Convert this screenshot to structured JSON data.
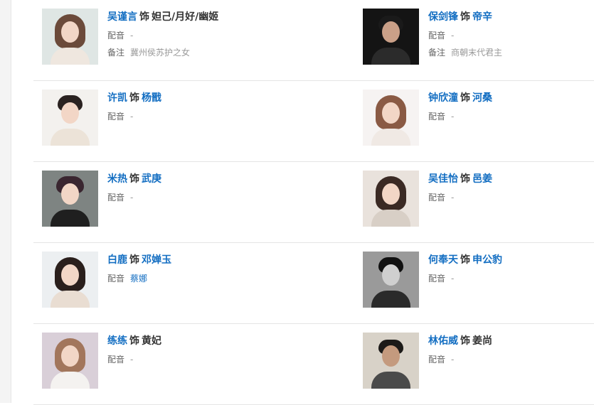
{
  "separator": "饰",
  "label_voice": "配音",
  "label_note": "备注",
  "rows": [
    {
      "left": {
        "actor": "吴谨言",
        "role": "妲己/月好/幽姬",
        "voice": "-",
        "note": "冀州侯苏护之女"
      },
      "right": {
        "actor": "保剑锋",
        "role": "帝辛",
        "voice": "-",
        "note": "商朝末代君主"
      }
    },
    {
      "left": {
        "actor": "许凯",
        "role": "杨戬",
        "voice": "-"
      },
      "right": {
        "actor": "钟欣潼",
        "role": "河桑",
        "voice": "-"
      }
    },
    {
      "left": {
        "actor": "米热",
        "role": "武庚",
        "voice": "-"
      },
      "right": {
        "actor": "吴佳怡",
        "role": "邑姜",
        "voice": "-"
      }
    },
    {
      "left": {
        "actor": "白鹿",
        "role": "邓婵玉",
        "voice": "蔡娜"
      },
      "right": {
        "actor": "何奉天",
        "role": "申公豹",
        "voice": "-"
      }
    },
    {
      "left": {
        "actor": "练练",
        "role": "黄妃",
        "voice": "-"
      },
      "right": {
        "actor": "林佑威",
        "role": "姜尚",
        "voice": "-"
      }
    }
  ]
}
